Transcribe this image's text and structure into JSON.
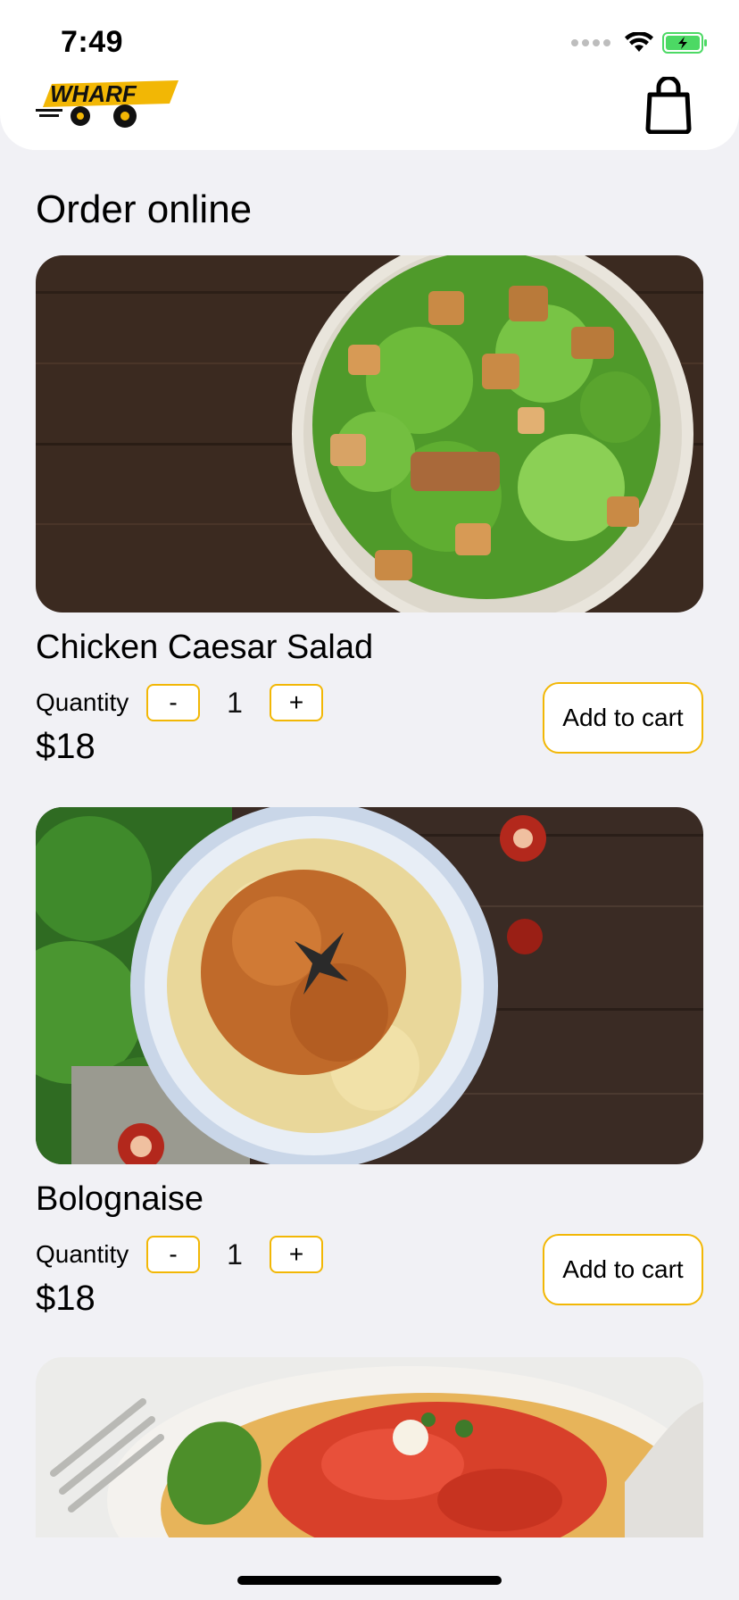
{
  "status_bar": {
    "time": "7:49"
  },
  "header": {
    "logo_text": "WHARF",
    "cart_icon": "shopping-bag-icon"
  },
  "page": {
    "title": "Order online"
  },
  "colors": {
    "accent": "#f2b705",
    "background": "#f1f1f5",
    "battery": "#4cd964"
  },
  "items": [
    {
      "name": "Chicken Caesar Salad",
      "quantity_label": "Quantity",
      "decrement": "-",
      "quantity": "1",
      "increment": "+",
      "price": "$18",
      "add_to_cart": "Add to cart"
    },
    {
      "name": "Bolognaise",
      "quantity_label": "Quantity",
      "decrement": "-",
      "quantity": "1",
      "increment": "+",
      "price": "$18",
      "add_to_cart": "Add to cart"
    }
  ]
}
